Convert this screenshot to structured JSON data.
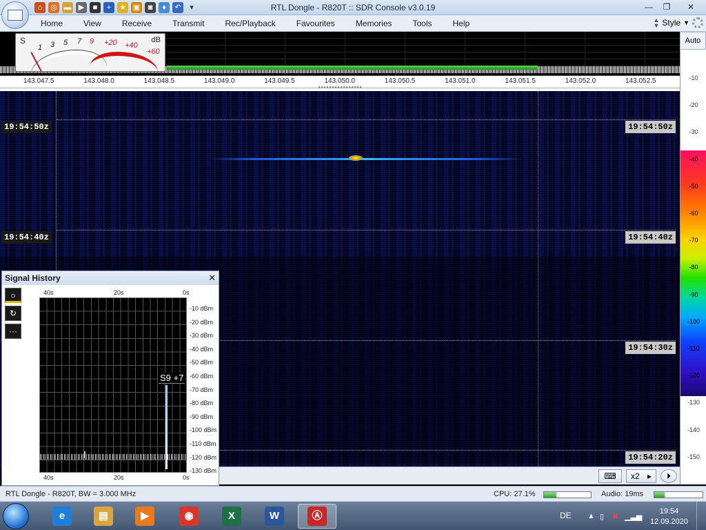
{
  "window": {
    "title": "RTL Dongle - R820T :: SDR Console v3.0.19",
    "min_label": "—",
    "max_label": "❐",
    "close_label": "✕"
  },
  "qat_icons": [
    "home-icon",
    "record-icon",
    "folder-icon",
    "play-icon",
    "stop-icon",
    "add-icon",
    "star-icon",
    "lock-icon",
    "camera-icon",
    "pin-icon",
    "undo-icon",
    "dropdown-icon"
  ],
  "ribbon": {
    "tabs": [
      "Home",
      "View",
      "Receive",
      "Transmit",
      "Rec/Playback",
      "Favourites",
      "Memories",
      "Tools",
      "Help"
    ],
    "style_label": "Style"
  },
  "smeter": {
    "s_label": "S",
    "db_label": "dB",
    "scale_white": [
      "1",
      "3",
      "5",
      "7",
      "9"
    ],
    "scale_red": [
      "+20",
      "+40",
      "+60"
    ]
  },
  "auto_label": "Auto",
  "freq_axis": [
    "143.047.5",
    "143.048.0",
    "143.048.5",
    "143.049.0",
    "143.049.5",
    "143.050.0",
    "143.050.5",
    "143.051.0",
    "143.051.5",
    "143.052.0",
    "143.052.5"
  ],
  "timestamps": [
    "19:54:50z",
    "19:54:40z",
    "19:54:30z",
    "19:54:20z"
  ],
  "db_scale": [
    "-10",
    "-20",
    "-30",
    "-40",
    "-50",
    "-60",
    "-70",
    "-80",
    "-90",
    "-100",
    "-110",
    "-120",
    "-130",
    "-140",
    "-150"
  ],
  "signal_history": {
    "title": "Signal History",
    "close_label": "✕",
    "tools": [
      "○",
      "↻",
      "···"
    ],
    "x_labels": [
      "40s",
      "20s",
      "0s"
    ],
    "y_labels": [
      "-10 dBm",
      "-20 dBm",
      "-30 dBm",
      "-40 dBm",
      "-50 dBm",
      "-60 dBm",
      "-70 dBm",
      "-80 dBm",
      "-90 dBm",
      "-100 dBm",
      "-110 dBm",
      "-120 dBm",
      "-130 dBm"
    ],
    "peak_label": "S9 +7"
  },
  "wf_controls": {
    "keyboard_label": "⌨",
    "zoom_label": "x2",
    "arrow_label": "▸",
    "step_label": "⏵"
  },
  "status": {
    "left": "RTL Dongle - R820T, BW = 3.000 MHz",
    "cpu": "CPU: 27.1%",
    "audio": "Audio: 19ms",
    "cpu_fraction": 0.271
  },
  "taskbar": {
    "apps": [
      {
        "name": "internet-explorer",
        "glyph": "e",
        "color": "#1e7fd8"
      },
      {
        "name": "file-explorer",
        "glyph": "▤",
        "color": "#d9a441"
      },
      {
        "name": "media-player",
        "glyph": "▶",
        "color": "#e8791f"
      },
      {
        "name": "chrome",
        "glyph": "◉",
        "color": "#d9352b"
      },
      {
        "name": "excel",
        "glyph": "X",
        "color": "#1e7145"
      },
      {
        "name": "word",
        "glyph": "W",
        "color": "#2b579a"
      },
      {
        "name": "sdr-console",
        "glyph": "Ⓐ",
        "color": "#c62828"
      }
    ],
    "language": "DE",
    "time": "19:54",
    "date": "12.09.2020"
  }
}
